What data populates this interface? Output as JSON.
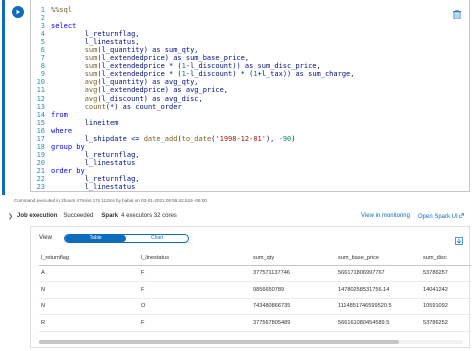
{
  "code_lines": [
    {
      "n": "1",
      "parts": [
        {
          "t": "%%sql",
          "c": "cm"
        }
      ]
    },
    {
      "n": "2",
      "parts": []
    },
    {
      "n": "3",
      "parts": [
        {
          "t": "select",
          "c": "kw"
        }
      ]
    },
    {
      "n": "4",
      "parts": [
        {
          "t": "        l_returnflag,",
          "c": "plain"
        }
      ]
    },
    {
      "n": "5",
      "parts": [
        {
          "t": "        l_linestatus,",
          "c": "plain"
        }
      ]
    },
    {
      "n": "6",
      "parts": [
        {
          "t": "        sum",
          "c": "fn"
        },
        {
          "t": "(l_quantity) as sum_qty,",
          "c": "plain"
        }
      ]
    },
    {
      "n": "7",
      "parts": [
        {
          "t": "        sum",
          "c": "fn"
        },
        {
          "t": "(l_extendedprice) as sum_base_price,",
          "c": "plain"
        }
      ]
    },
    {
      "n": "8",
      "parts": [
        {
          "t": "        sum",
          "c": "fn"
        },
        {
          "t": "(l_extendedprice * (",
          "c": "plain"
        },
        {
          "t": "1",
          "c": "num"
        },
        {
          "t": "-l_discount)) as sum_disc_price,",
          "c": "plain"
        }
      ]
    },
    {
      "n": "9",
      "parts": [
        {
          "t": "        sum",
          "c": "fn"
        },
        {
          "t": "(l_extendedprice * (",
          "c": "plain"
        },
        {
          "t": "1",
          "c": "num"
        },
        {
          "t": "-l_discount) * (",
          "c": "plain"
        },
        {
          "t": "1",
          "c": "num"
        },
        {
          "t": "+l_tax)) as sum_charge,",
          "c": "plain"
        }
      ]
    },
    {
      "n": "10",
      "parts": [
        {
          "t": "        avg",
          "c": "fn"
        },
        {
          "t": "(l_quantity) as avg_qty,",
          "c": "plain"
        }
      ]
    },
    {
      "n": "11",
      "parts": [
        {
          "t": "        avg",
          "c": "fn"
        },
        {
          "t": "(l_extendedprice) as avg_price,",
          "c": "plain"
        }
      ]
    },
    {
      "n": "12",
      "parts": [
        {
          "t": "        avg",
          "c": "fn"
        },
        {
          "t": "(l_discount) as avg_disc,",
          "c": "plain"
        }
      ]
    },
    {
      "n": "13",
      "parts": [
        {
          "t": "        count",
          "c": "fn"
        },
        {
          "t": "(*) as count_order",
          "c": "plain"
        }
      ]
    },
    {
      "n": "14",
      "parts": [
        {
          "t": "from",
          "c": "kw"
        }
      ]
    },
    {
      "n": "15",
      "parts": [
        {
          "t": "        lineitem",
          "c": "plain"
        }
      ]
    },
    {
      "n": "16",
      "parts": [
        {
          "t": "where",
          "c": "kw"
        }
      ]
    },
    {
      "n": "17",
      "parts": [
        {
          "t": "        l_shipdate <= ",
          "c": "plain"
        },
        {
          "t": "date_add",
          "c": "fn"
        },
        {
          "t": "(",
          "c": "plain"
        },
        {
          "t": "to_date",
          "c": "fn"
        },
        {
          "t": "(",
          "c": "plain"
        },
        {
          "t": "'1998-12-01'",
          "c": "str"
        },
        {
          "t": "), ",
          "c": "plain"
        },
        {
          "t": "-90",
          "c": "num"
        },
        {
          "t": ")",
          "c": "plain"
        }
      ]
    },
    {
      "n": "18",
      "parts": [
        {
          "t": "group by",
          "c": "kw"
        }
      ]
    },
    {
      "n": "19",
      "parts": [
        {
          "t": "        l_returnflag,",
          "c": "plain"
        }
      ]
    },
    {
      "n": "20",
      "parts": [
        {
          "t": "        l_linestatus",
          "c": "plain"
        }
      ]
    },
    {
      "n": "21",
      "parts": [
        {
          "t": "order by",
          "c": "kw"
        }
      ]
    },
    {
      "n": "22",
      "parts": [
        {
          "t": "        l_returnflag,",
          "c": "plain"
        }
      ]
    },
    {
      "n": "23",
      "parts": [
        {
          "t": "        l_linestatus",
          "c": "plain"
        }
      ]
    }
  ],
  "exec_info": "Command executed in 2hours 47mins 17s 112ms by babal on 03-01-2021 09:55:42.519 -06:00",
  "job": {
    "label": "Job execution",
    "status": "Succeeded",
    "spark_label": "Spark",
    "spark_info": "4 executors 32 cores",
    "monitor_link": "View in monitoring",
    "spark_ui_link": "Open Spark UI"
  },
  "view": {
    "label": "View",
    "table_tab": "Table",
    "chart_tab": "Chart"
  },
  "table": {
    "columns": [
      "l_returnflag",
      "l_linestatus",
      "sum_qty",
      "sum_base_price",
      "sum_disc"
    ],
    "rows": [
      [
        "A",
        "F",
        "377571137746",
        "566171806997767",
        "53786257"
      ],
      [
        "N",
        "F",
        "9856650789",
        "14780258531756.14",
        "14041242"
      ],
      [
        "N",
        "O",
        "743480866735",
        "1114851746599520.5",
        "10591092"
      ],
      [
        "R",
        "F",
        "377567805489",
        "566161080454589.5",
        "53786252"
      ]
    ]
  },
  "colors": {
    "accent": "#0f6cbd",
    "keyword": "#0000ff",
    "function": "#795e26",
    "string": "#a31515",
    "number": "#098658"
  }
}
